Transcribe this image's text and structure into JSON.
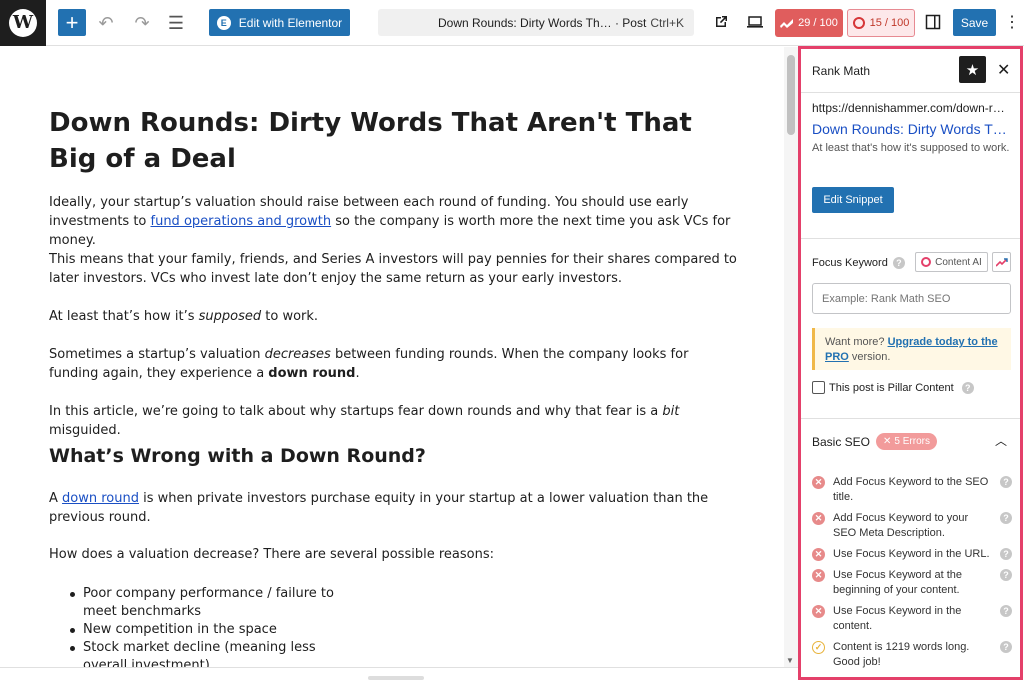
{
  "toolbar": {
    "wp_logo": "W",
    "add_icon": "+",
    "undo_icon": "↶",
    "redo_icon": "↷",
    "list_icon": "☰",
    "elementor_label": "Edit with Elementor",
    "command_title": "Down Rounds: Dirty Words Th… · Post",
    "command_shortcut": "Ctrl+K",
    "score_seo": "29 / 100",
    "score_content": "15 / 100",
    "save_label": "Save",
    "more_icon": "⋮"
  },
  "article": {
    "title": "Down Rounds: Dirty Words That Aren't That Big of a Deal",
    "p1_before": "Ideally, your startup’s valuation should raise between each round of funding. You should use early investments to ",
    "p1_link": "fund operations and growth",
    "p1_after": " so the company is worth more the next time you ask VCs for money.",
    "p2": "This means that your family, friends, and Series A investors will pay pennies for their shares compared to later investors. VCs who invest late don’t enjoy the same return as your early investors.",
    "p3_before": "At least that’s how it’s ",
    "p3_em": "supposed",
    "p3_after": " to work.",
    "p4_before": "Sometimes a startup’s valuation ",
    "p4_em": "decreases",
    "p4_mid": " between funding rounds. When the company looks for funding again, they experience a ",
    "p4_strong": "down round",
    "p4_after": ".",
    "p5_before": "In this article, we’re going to talk about why startups fear down rounds and why that fear is a ",
    "p5_em": "bit",
    "p5_after": " misguided.",
    "h2": "What’s Wrong with a Down Round?",
    "p6_before": "A ",
    "p6_link": "down round",
    "p6_after": " is when private investors purchase equity in your startup at a lower valuation than the previous round.",
    "p7": "How does a valuation decrease? There are several possible reasons:",
    "bullets": [
      "Poor company performance / failure to meet benchmarks",
      "New competition in the space",
      "Stock market decline (meaning less overall investment)"
    ]
  },
  "rank_math": {
    "title": "Rank Math",
    "star_icon": "★",
    "close_icon": "✕",
    "snippet_url": "https://dennishammer.com/down-r…",
    "snippet_title": "Down Rounds: Dirty Words Th…",
    "snippet_desc": "At least that's how it's supposed to work.",
    "edit_snippet": "Edit Snippet",
    "focus_keyword_label": "Focus Keyword",
    "content_ai": "Content AI",
    "focus_placeholder": "Example: Rank Math SEO",
    "upgrade_before": "Want more? ",
    "upgrade_link": "Upgrade today to the PRO",
    "upgrade_after": " version.",
    "pillar_label": "This post is Pillar Content",
    "basic_seo": "Basic SEO",
    "errors_badge": "5 Errors",
    "checks": [
      {
        "text": "Add Focus Keyword to the SEO title.",
        "status": "error"
      },
      {
        "text": "Add Focus Keyword to your SEO Meta Description.",
        "status": "error"
      },
      {
        "text": "Use Focus Keyword in the URL.",
        "status": "error"
      },
      {
        "text": "Use Focus Keyword at the beginning of your content.",
        "status": "error"
      },
      {
        "text": "Use Focus Keyword in the content.",
        "status": "error"
      },
      {
        "text": "Content is 1219 words long. Good job!",
        "status": "ok"
      }
    ]
  },
  "colors": {
    "accent": "#2271b1",
    "rank_math_pink": "#e4406a",
    "error": "#e78a8a",
    "warning": "#e8b33b"
  }
}
